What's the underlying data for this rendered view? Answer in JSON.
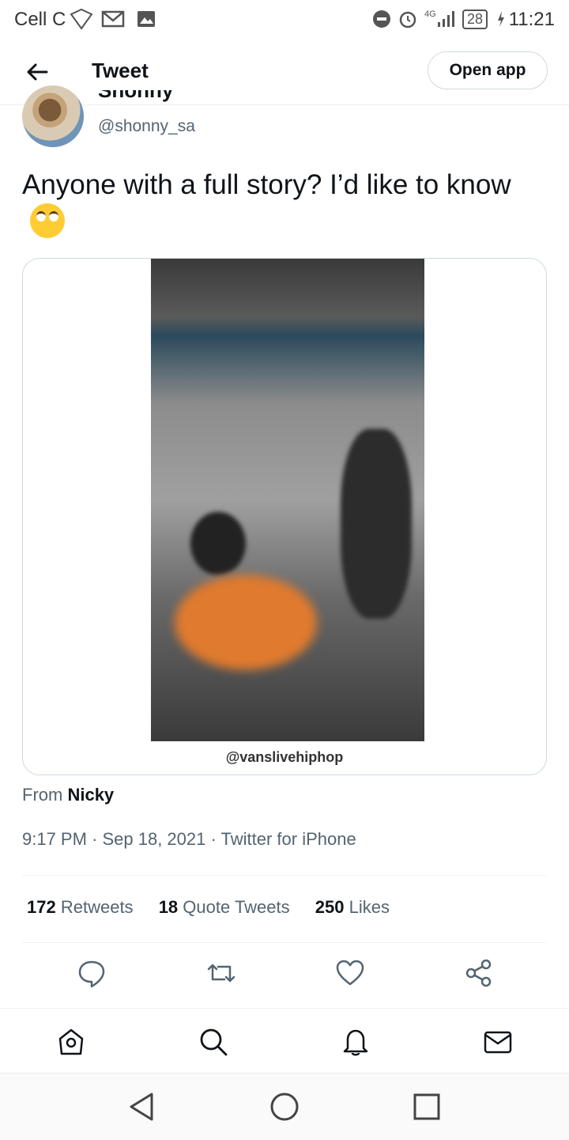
{
  "status_bar": {
    "carrier": "Cell C",
    "network": "4G",
    "battery": "28",
    "time": "11:21"
  },
  "header": {
    "title": "Tweet",
    "open_app_label": "Open app"
  },
  "tweet": {
    "display_name": "Shonny",
    "handle": "@shonny_sa",
    "text": "Anyone with a full story? I’d like to know",
    "media_watermark": "@vanslivehiphop",
    "source_prefix": "From",
    "source_name": "Nicky",
    "meta": "9:17 PM · Sep 18, 2021 · Twitter for iPhone",
    "stats": {
      "retweets_count": "172",
      "retweets_label": "Retweets",
      "quotes_count": "18",
      "quotes_label": "Quote Tweets",
      "likes_count": "250",
      "likes_label": "Likes"
    }
  },
  "icons": {
    "actions": [
      "reply-icon",
      "retweet-icon",
      "like-icon",
      "share-icon"
    ],
    "bottom_nav": [
      "home-icon",
      "search-icon",
      "notifications-icon",
      "messages-icon"
    ],
    "system_nav": [
      "back-triangle-icon",
      "home-circle-icon",
      "recents-square-icon"
    ]
  },
  "colors": {
    "text": "#0f1419",
    "muted": "#536471",
    "border": "#cfd9de"
  }
}
